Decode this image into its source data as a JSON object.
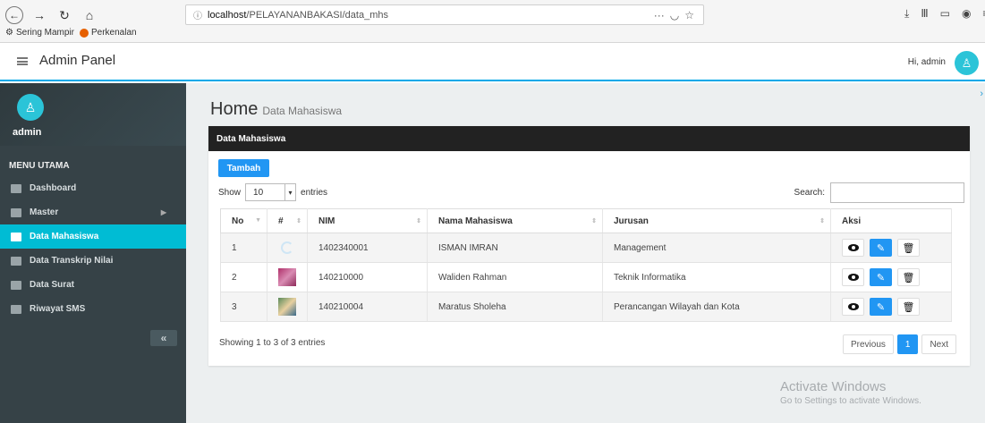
{
  "browser": {
    "url_host": "localhost",
    "url_path": "/PELAYANANBAKASI/data_mhs",
    "url_info_icon": "info-icon",
    "bookmarks": [
      "Sering Mampir",
      "Perkenalan"
    ]
  },
  "header": {
    "title": "Admin Panel",
    "greeting": "Hi, admin"
  },
  "sidebar": {
    "user_name": "admin",
    "menu_title": "MENU UTAMA",
    "items": [
      {
        "label": "Dashboard",
        "icon": "home-icon"
      },
      {
        "label": "Master",
        "icon": "puzzle-icon"
      },
      {
        "label": "Data Mahasiswa",
        "icon": "id-card-icon"
      },
      {
        "label": "Data Transkrip Nilai",
        "icon": "clipboard-icon"
      },
      {
        "label": "Data Surat",
        "icon": "envelope-icon"
      },
      {
        "label": "Riwayat SMS",
        "icon": "send-icon"
      }
    ],
    "collapse_glyph": "«"
  },
  "page": {
    "title": "Home",
    "subtitle": "Data Mahasiswa"
  },
  "panel": {
    "heading": "Data Mahasiswa",
    "add_button": "Tambah",
    "show_label": "Show",
    "entries_value": "10",
    "entries_label": "entries",
    "search_label": "Search:",
    "columns": [
      "No",
      "#",
      "NIM",
      "Nama Mahasiswa",
      "Jurusan",
      "Aksi"
    ],
    "rows": [
      {
        "no": "1",
        "nim": "1402340001",
        "nama": "ISMAN IMRAN",
        "jurusan": "Management"
      },
      {
        "no": "2",
        "nim": "140210000",
        "nama": "Waliden Rahman",
        "jurusan": "Teknik Informatika"
      },
      {
        "no": "3",
        "nim": "140210004",
        "nama": "Maratus Sholeha",
        "jurusan": "Perancangan Wilayah dan Kota"
      }
    ],
    "info": "Showing 1 to 3 of 3 entries",
    "pager": {
      "previous": "Previous",
      "current": "1",
      "next": "Next"
    }
  },
  "watermark": {
    "line1": "Activate Windows",
    "line2": "Go to Settings to activate Windows."
  },
  "colors": {
    "accent": "#00bcd4",
    "primary_button": "#2196f3",
    "sidebar_bg": "#364247",
    "panel_head": "#222222"
  }
}
